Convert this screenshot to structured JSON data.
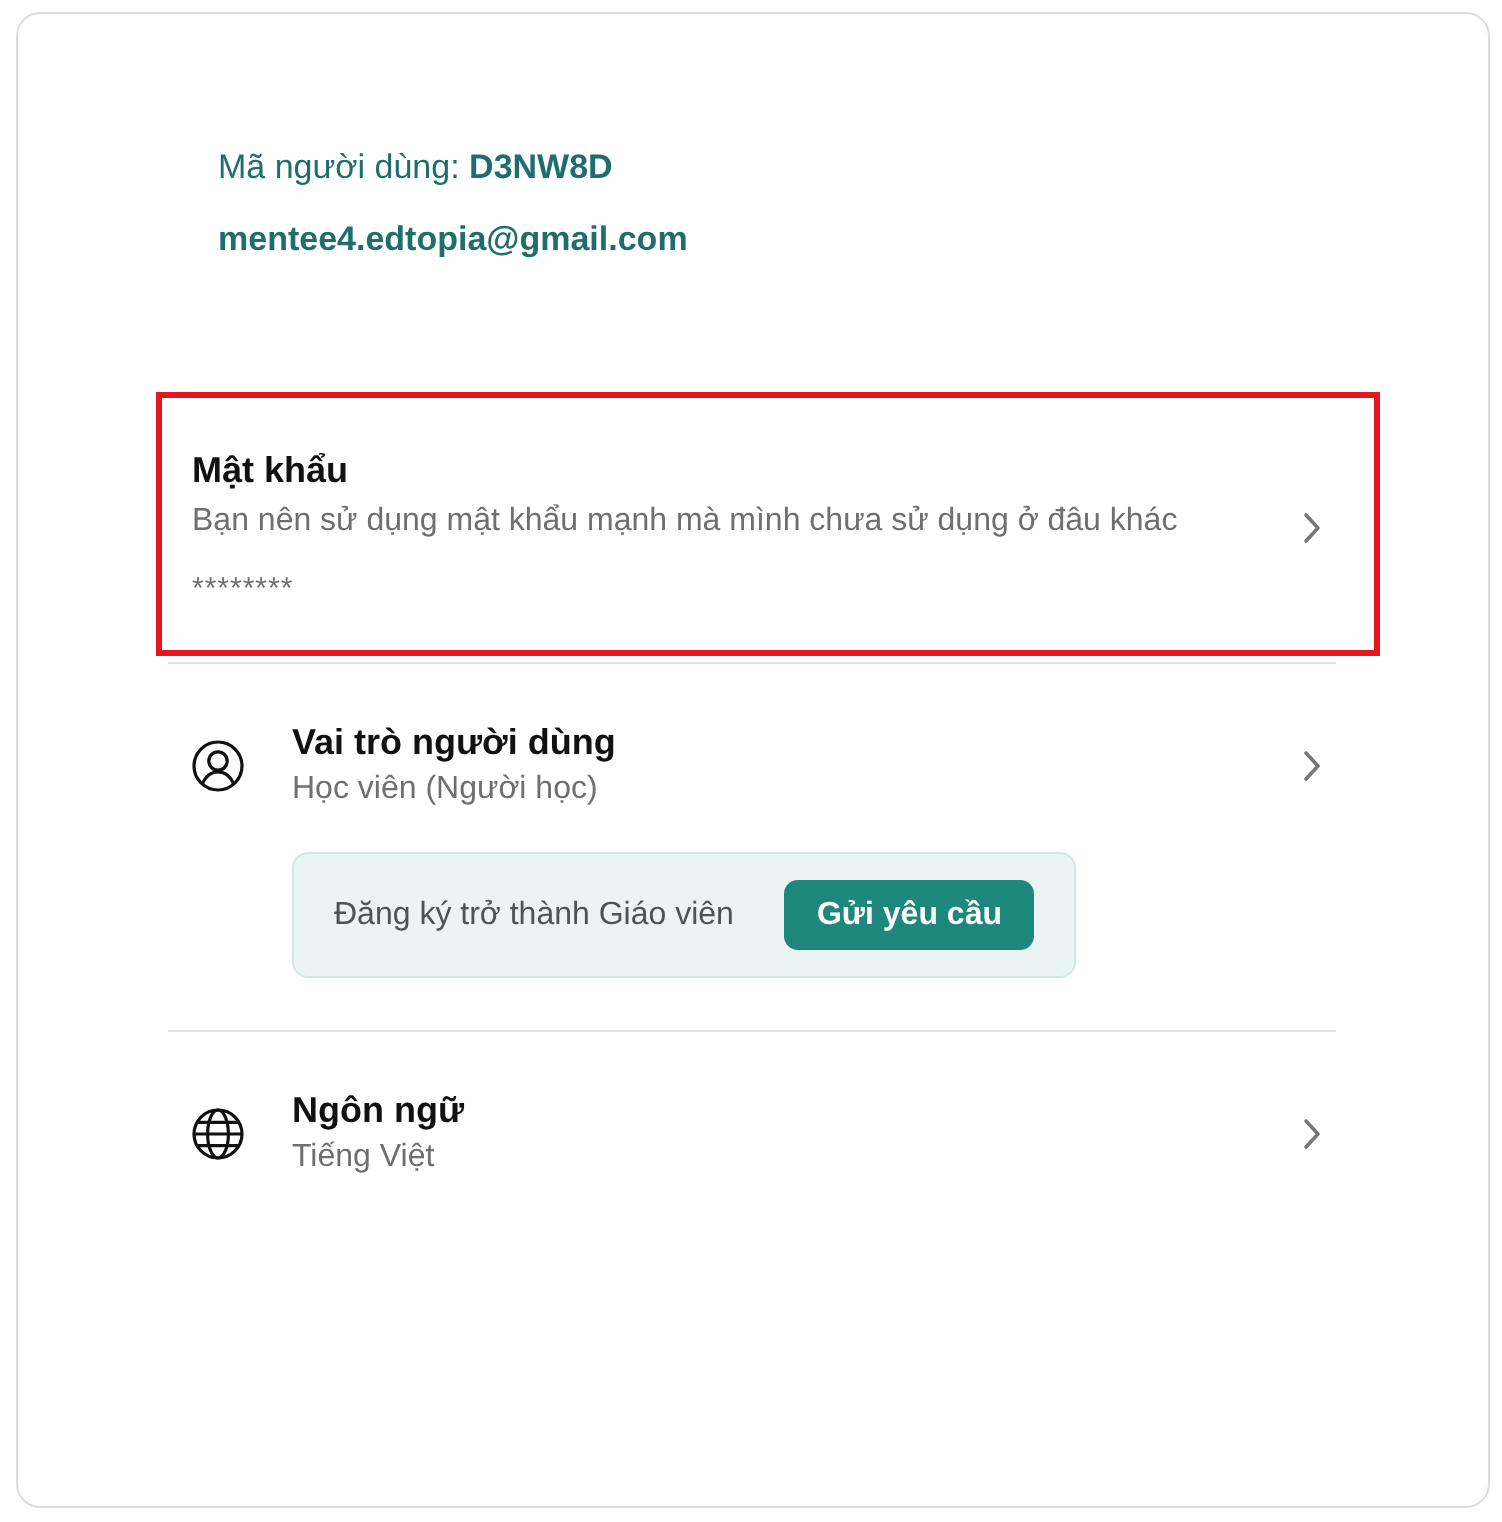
{
  "account": {
    "user_code": "Mã người dùng: **D3NW8D**",
    "email": "mentee4.edtopia@gmail.com"
  },
  "settings": [
    {
      "kind": "password",
      "title": "Mật khẩu",
      "description": "Bạn nên sử dụng mật khẩu mạnh mà mình chưa sử dụng ở đâu khác",
      "value": "********",
      "highlighted": true
    },
    {
      "kind": "role",
      "title": "Vai trò người dùng",
      "value": "Học viên (Người học)",
      "highlighted": false,
      "request": {
        "text": "Đăng ký trở thành Giáo viên",
        "button": "Gửi yêu cầu"
      }
    },
    {
      "kind": "language",
      "title": "Ngôn ngữ",
      "value": "Tiếng Việt",
      "highlighted": false
    }
  ]
}
